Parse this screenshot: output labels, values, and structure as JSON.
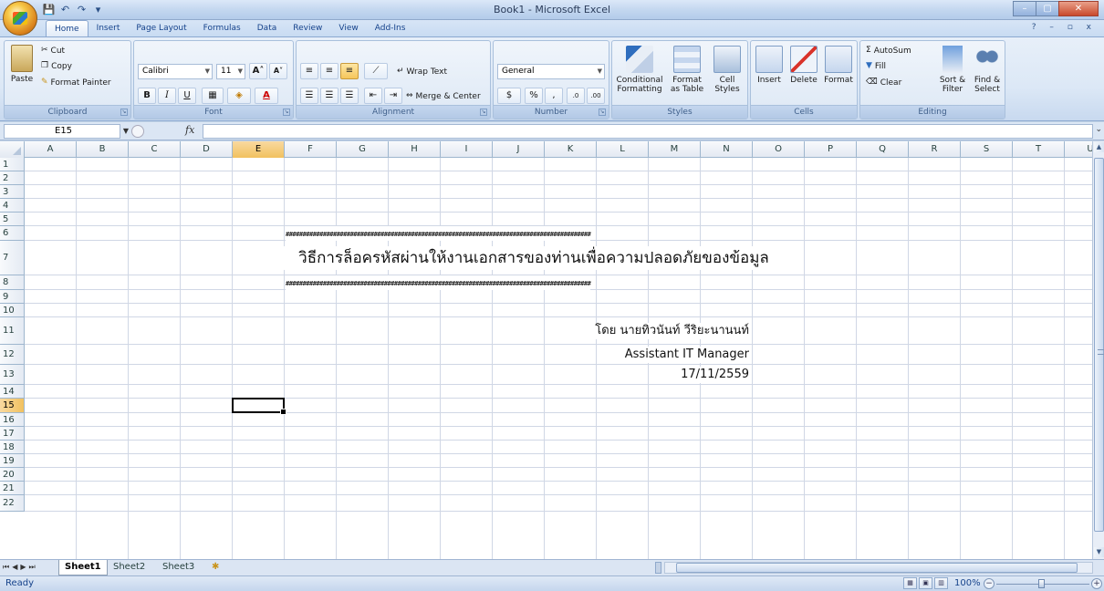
{
  "window": {
    "title": "Book1 - Microsoft Excel",
    "controls": [
      "–",
      "▢",
      "✕"
    ]
  },
  "qat": [
    "💾",
    "↶",
    "↷",
    "▾"
  ],
  "tabs": [
    "Home",
    "Insert",
    "Page Layout",
    "Formulas",
    "Data",
    "Review",
    "View",
    "Add-Ins"
  ],
  "active_tab": "Home",
  "mdi_controls": "? – ▫ x",
  "ribbon": {
    "clipboard": {
      "label": "Clipboard",
      "paste": "Paste",
      "cut": "Cut",
      "copy": "Copy",
      "format_painter": "Format Painter"
    },
    "font": {
      "label": "Font",
      "name": "Calibri",
      "size": "11",
      "grow": "A˄",
      "shrink": "A˅",
      "bold": "B",
      "italic": "I",
      "underline": "U",
      "border": "▦",
      "fill": "◈",
      "color": "A"
    },
    "alignment": {
      "label": "Alignment",
      "wrap": "Wrap Text",
      "merge": "Merge & Center"
    },
    "number": {
      "label": "Number",
      "format": "General",
      "currency": "$",
      "percent": "%",
      "comma": ",",
      "inc_dec": ".0",
      "dec_dec": ".00"
    },
    "styles": {
      "label": "Styles",
      "conditional": "Conditional Formatting",
      "format_table": "Format as Table",
      "cell_styles": "Cell Styles"
    },
    "cells": {
      "label": "Cells",
      "insert": "Insert",
      "delete": "Delete",
      "format": "Format"
    },
    "editing": {
      "label": "Editing",
      "autosum": "AutoSum",
      "fill": "Fill",
      "clear": "Clear",
      "sort_filter": "Sort & Filter",
      "find_select": "Find & Select"
    }
  },
  "formula_bar": {
    "name_box": "E15",
    "fx": "fx",
    "content": ""
  },
  "columns": [
    "A",
    "B",
    "C",
    "D",
    "E",
    "F",
    "G",
    "H",
    "I",
    "J",
    "K",
    "L",
    "M",
    "N",
    "O",
    "P",
    "Q",
    "R",
    "S",
    "T",
    "U"
  ],
  "rows": [
    "1",
    "2",
    "3",
    "4",
    "5",
    "6",
    "7",
    "8",
    "9",
    "10",
    "11",
    "12",
    "13",
    "14",
    "15",
    "16",
    "17",
    "18",
    "19",
    "20",
    "21",
    "22"
  ],
  "selected_cell": {
    "col": "E",
    "row": "15"
  },
  "cells": {
    "hash_row6": "##########################################################################################",
    "title_row7": "วิธีการล็อครหัสผ่านให้งานเอกสารของท่านเพื่อความปลอดภัยของข้อมูล",
    "hash_row8": "##########################################################################################",
    "author_row11": "โดย นายทิวนันท์ วีริยะนานนท์",
    "role_row12": "Assistant IT Manager",
    "date_row13": "17/11/2559"
  },
  "sheets": [
    "Sheet1",
    "Sheet2",
    "Sheet3"
  ],
  "active_sheet": "Sheet1",
  "status": {
    "text": "Ready",
    "zoom": "100%"
  },
  "colors": {
    "accent": "#15428b",
    "selected_header": "#f1c15f",
    "grid": "#d0d7e5"
  }
}
